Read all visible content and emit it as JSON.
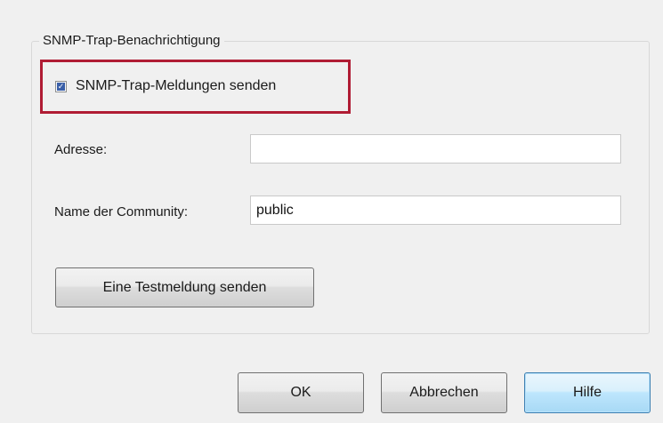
{
  "group": {
    "title": "SNMP-Trap-Benachrichtigung"
  },
  "send_traps": {
    "label": "SNMP-Trap-Meldungen senden",
    "checked": true
  },
  "address": {
    "label": "Adresse:",
    "value": ""
  },
  "community": {
    "label": "Name der Community:",
    "value": "public"
  },
  "test_button": {
    "label": "Eine Testmeldung senden"
  },
  "footer": {
    "ok_label": "OK",
    "cancel_label": "Abbrechen",
    "help_label": "Hilfe"
  },
  "colors": {
    "highlight_border": "#b01c34",
    "checkbox_check": "#3a5fa8",
    "dialog_background": "#f0f0f0"
  }
}
